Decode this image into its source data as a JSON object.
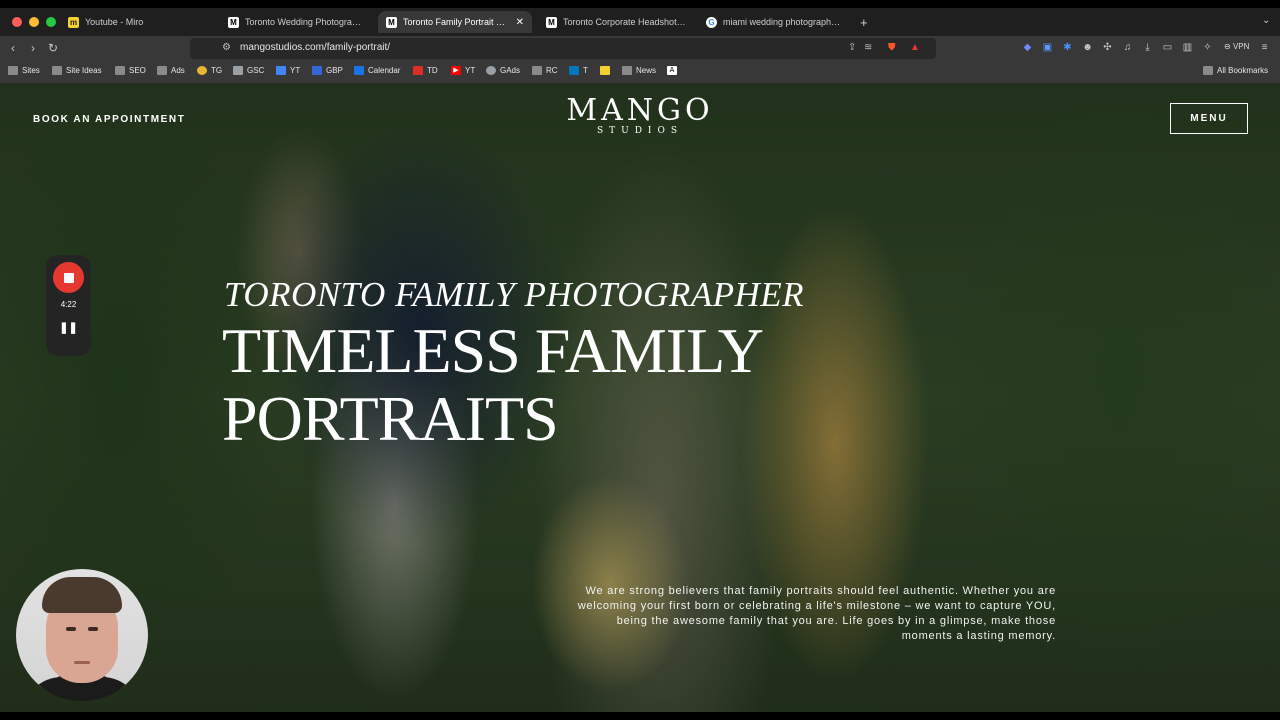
{
  "browser": {
    "tabs": [
      {
        "label": "Youtube - Miro",
        "favicon": "miro-icon",
        "color": "#f5d033"
      },
      {
        "label": "Toronto Wedding Photographers",
        "favicon": "mango-icon",
        "color": "#ffffff"
      },
      {
        "label": "Toronto Family Portrait Photo",
        "favicon": "mango-icon",
        "color": "#ffffff",
        "active": true
      },
      {
        "label": "Toronto Corporate Headshots | C",
        "favicon": "mango-icon",
        "color": "#ffffff"
      },
      {
        "label": "miami wedding photographer - G",
        "favicon": "google-icon",
        "color": "#4285f4"
      }
    ],
    "url": "mangostudios.com/family-portrait/",
    "vpn_label": "VPN",
    "bookmarks": [
      {
        "label": "Sites",
        "icon": "folder-icon"
      },
      {
        "label": "Site Ideas",
        "icon": "folder-icon"
      },
      {
        "label": "SEO",
        "icon": "folder-icon"
      },
      {
        "label": "Ads",
        "icon": "folder-icon"
      },
      {
        "label": "TG",
        "icon": "tg-icon"
      },
      {
        "label": "GSC",
        "icon": "gsc-icon"
      },
      {
        "label": "YT",
        "icon": "docs-icon"
      },
      {
        "label": "GBP",
        "icon": "gbp-icon"
      },
      {
        "label": "Calendar",
        "icon": "calendar-icon"
      },
      {
        "label": "TD",
        "icon": "td-icon"
      },
      {
        "label": "YT",
        "icon": "youtube-icon"
      },
      {
        "label": "GAds",
        "icon": "gads-icon"
      },
      {
        "label": "RC",
        "icon": "folder-icon"
      },
      {
        "label": "T",
        "icon": "trello-icon"
      },
      {
        "label": "",
        "icon": "miro-icon"
      },
      {
        "label": "News",
        "icon": "folder-icon"
      },
      {
        "label": "",
        "icon": "a-icon"
      }
    ],
    "all_bookmarks": "All Bookmarks"
  },
  "site": {
    "book_label": "BOOK AN APPOINTMENT",
    "logo_main": "MANGO",
    "logo_sub": "STUDIOS",
    "menu_label": "MENU",
    "subtitle": "TORONTO FAMILY PHOTOGRAPHER",
    "headline_line1": "TIMELESS FAMILY",
    "headline_line2": "PORTRAITS",
    "description": "We are strong believers that family portraits should feel authentic. Whether you are welcoming your first born or celebrating a life's milestone – we want to capture YOU, being the awesome family that you are. Life goes by in a glimpse, make those moments a lasting memory."
  },
  "recorder": {
    "time": "4:22"
  },
  "colors": {
    "record_red": "#e5392f",
    "tab_bg": "#1f1f1f",
    "toolbar_bg": "#383838"
  }
}
